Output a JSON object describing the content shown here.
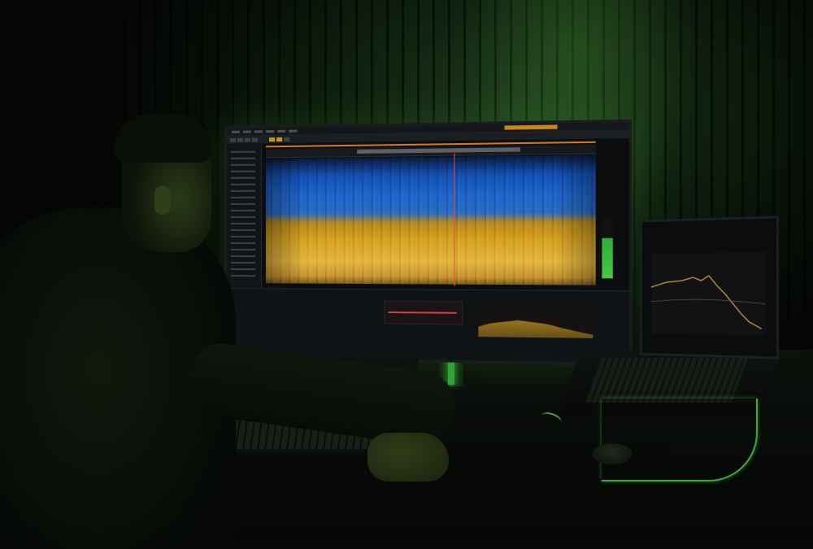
{
  "scene": {
    "description_label": "",
    "colors": {
      "wall_green": "#1c3a1c",
      "spectrogram_blue": "#1e66c8",
      "spectrogram_gold": "#d6a324",
      "accent_orange": "#d27a1c",
      "meter_green": "#48c844",
      "playhead_red": "#e04a3a",
      "cable_green": "#3fa93c"
    },
    "icons": [
      "monitor-icon",
      "laptop-icon",
      "keyboard-icon",
      "mouse-icon"
    ]
  },
  "monitor": {
    "app_title": ""
  },
  "laptop": {
    "screen_title": ""
  }
}
